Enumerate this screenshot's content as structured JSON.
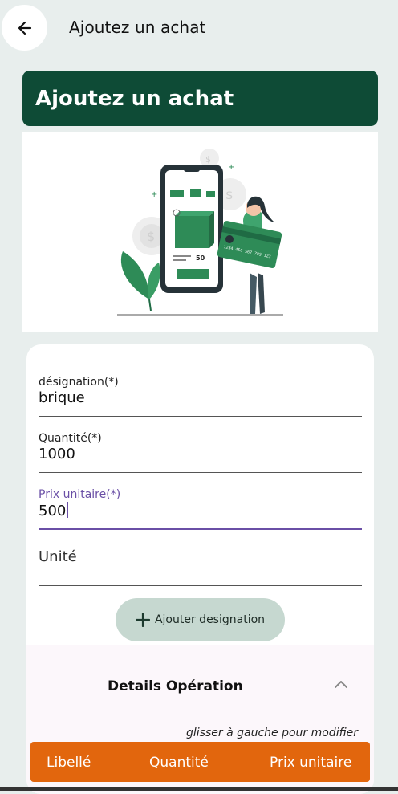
{
  "appbar": {
    "title": "Ajoutez un achat"
  },
  "banner": {
    "title": "Ajoutez un achat"
  },
  "form": {
    "designation": {
      "label": "désignation(*)",
      "value": "brique"
    },
    "quantite": {
      "label": "Quantité(*)",
      "value": "1000"
    },
    "prix_unitaire": {
      "label": "Prix unitaire(*)",
      "value": "500"
    },
    "unite": {
      "placeholder": "Unité"
    }
  },
  "add_button": {
    "label": "Ajouter designation"
  },
  "details": {
    "title": "Details Opération",
    "hint": "glisser à gauche pour modifier"
  },
  "table": {
    "columns": [
      "Libellé",
      "Quantité",
      "Prix unitaire"
    ]
  },
  "illustration": {
    "price_tag": "50",
    "card_number": "1234 456 567 789 123"
  },
  "colors": {
    "primary": "#0e4b36",
    "accent": "#e2660d",
    "focus": "#6a4fa6"
  }
}
